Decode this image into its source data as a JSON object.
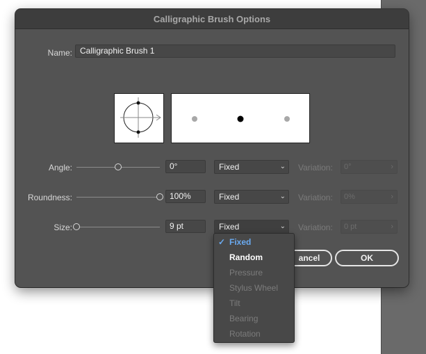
{
  "dialog": {
    "title": "Calligraphic Brush Options",
    "name_label": "Name:",
    "name_value": "Calligraphic Brush 1"
  },
  "rows": [
    {
      "label": "Angle:",
      "value": "0°",
      "mode": "Fixed",
      "variation_label": "Variation:",
      "variation_value": "0°"
    },
    {
      "label": "Roundness:",
      "value": "100%",
      "mode": "Fixed",
      "variation_label": "Variation:",
      "variation_value": "0%"
    },
    {
      "label": "Size:",
      "value": "9 pt",
      "mode": "Fixed",
      "variation_label": "Variation:",
      "variation_value": "0 pt"
    }
  ],
  "sliders": {
    "angle_level": 0.5,
    "roundness_level": 1.0,
    "size_level": 0.0
  },
  "buttons": {
    "cancel": "ancel",
    "ok": "OK"
  },
  "menu": {
    "check_glyph": "✓",
    "items": [
      {
        "label": "Fixed",
        "state": "selected"
      },
      {
        "label": "Random",
        "state": "enabled"
      },
      {
        "label": "Pressure",
        "state": "disabled"
      },
      {
        "label": "Stylus Wheel",
        "state": "disabled"
      },
      {
        "label": "Tilt",
        "state": "disabled"
      },
      {
        "label": "Bearing",
        "state": "disabled"
      },
      {
        "label": "Rotation",
        "state": "disabled"
      }
    ]
  },
  "icons": {
    "chevron": "chevron-down-icon",
    "stepper": "chevron-right-icon"
  },
  "colors": {
    "dialog_bg": "#535353",
    "titlebar_bg": "#3d3d3d",
    "accent": "#6aaaf0"
  }
}
